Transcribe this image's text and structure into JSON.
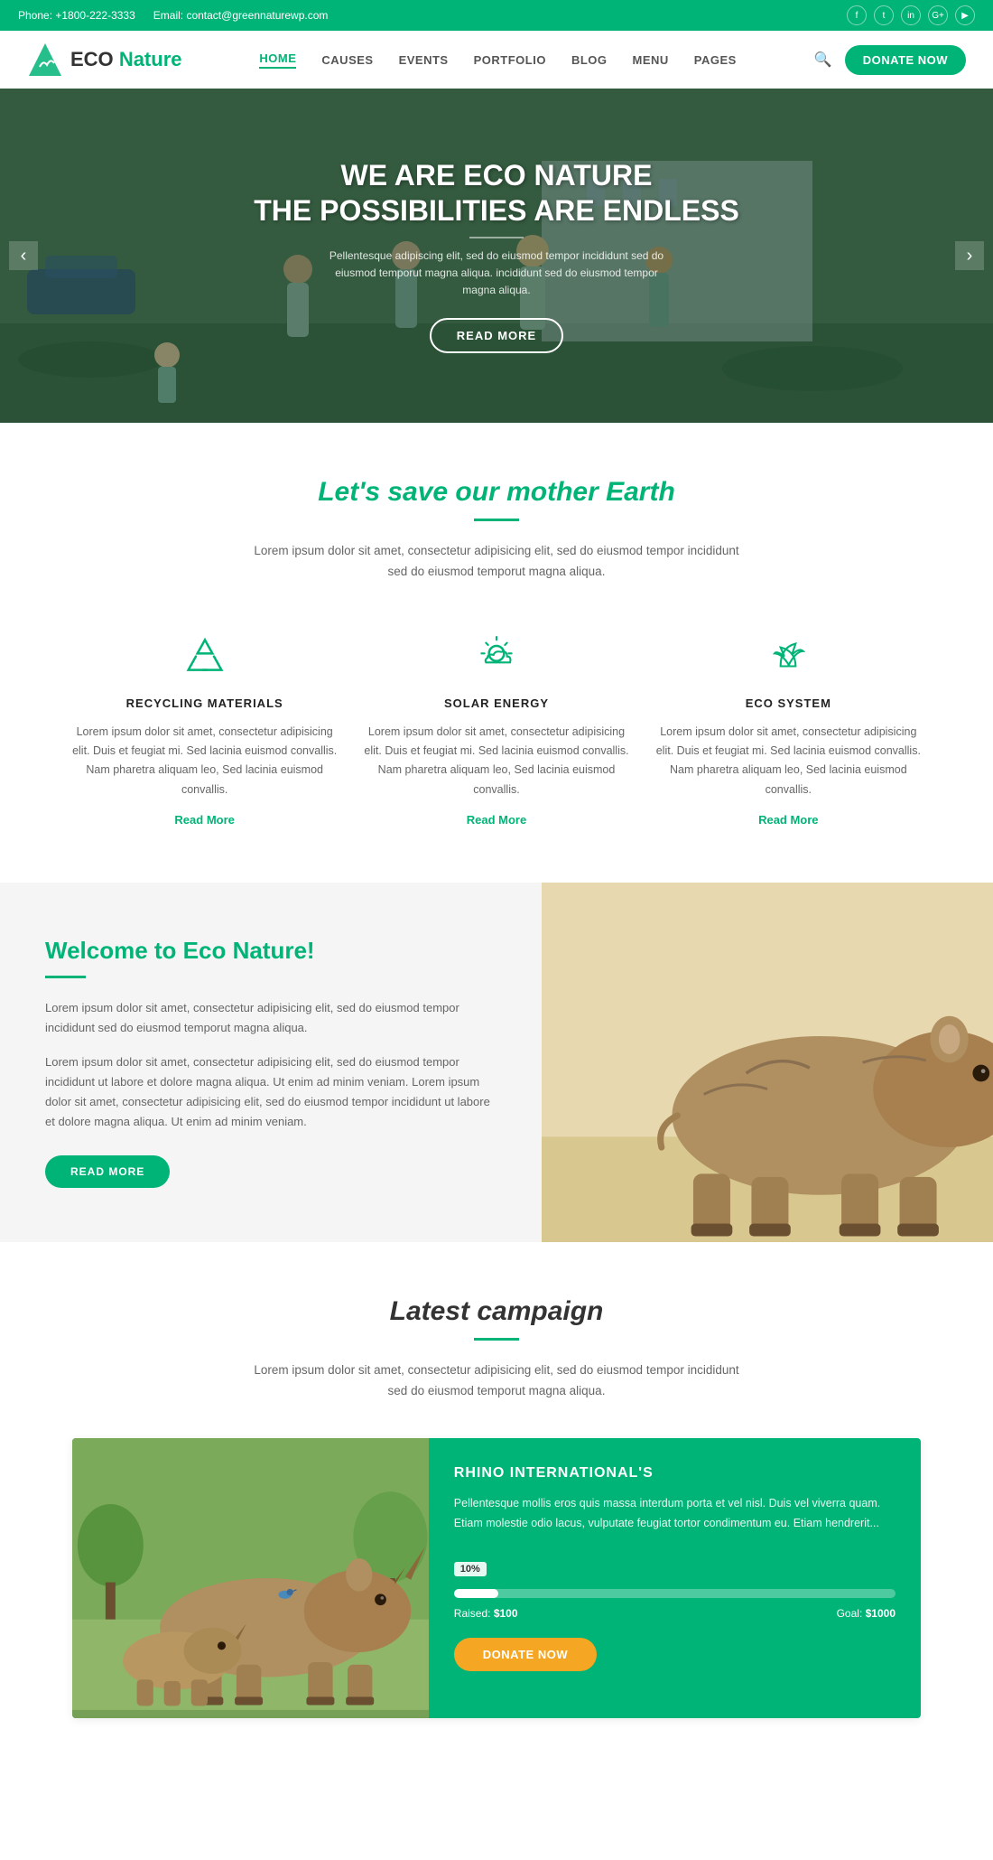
{
  "topbar": {
    "phone": "Phone: +1800-222-3333",
    "email": "Email: contact@greennaturewp.com",
    "socials": [
      "f",
      "t",
      "in",
      "G+",
      "▶"
    ]
  },
  "header": {
    "logo_eco": "ECO",
    "logo_nature": "Nature",
    "nav_items": [
      "HOME",
      "CAUSES",
      "EVENTS",
      "PORTFOLIO",
      "BLOG",
      "MENU",
      "PAGES"
    ],
    "donate_label": "DONATE NOW"
  },
  "hero": {
    "title_line1": "WE ARE ECO NATURE",
    "title_line2": "THE POSSIBILITIES ARE ENDLESS",
    "description": "Pellentesque adipiscing elit, sed do eiusmod tempor incididunt sed do eiusmod temporut magna aliqua. incididunt sed do eiusmod tempor magna aliqua.",
    "cta_label": "READ MORE",
    "prev_label": "‹",
    "next_label": "›"
  },
  "save_earth": {
    "title": "Let's save our mother Earth",
    "description": "Lorem ipsum dolor sit amet, consectetur adipisicing elit, sed do eiusmod tempor incididunt sed do eiusmod temporut magna aliqua.",
    "features": [
      {
        "id": "recycling",
        "title": "RECYCLING MATERIALS",
        "description": "Lorem ipsum dolor sit amet, consectetur adipisicing elit. Duis et feugiat mi. Sed lacinia euismod convallis. Nam pharetra aliquam leo, Sed lacinia euismod convallis.",
        "read_more": "Read More"
      },
      {
        "id": "solar",
        "title": "SOLAR ENERGY",
        "description": "Lorem ipsum dolor sit amet, consectetur adipisicing elit. Duis et feugiat mi. Sed lacinia euismod convallis. Nam pharetra aliquam leo, Sed lacinia euismod convallis.",
        "read_more": "Read More"
      },
      {
        "id": "ecosystem",
        "title": "ECO SYSTEM",
        "description": "Lorem ipsum dolor sit amet, consectetur adipisicing elit. Duis et feugiat mi. Sed lacinia euismod convallis. Nam pharetra aliquam leo, Sed lacinia euismod convallis.",
        "read_more": "Read More"
      }
    ]
  },
  "welcome": {
    "title": "Welcome to Eco Nature!",
    "para1": "Lorem ipsum dolor sit amet, consectetur adipisicing elit, sed do eiusmod tempor incididunt sed do eiusmod temporut magna aliqua.",
    "para2": "Lorem ipsum dolor sit amet, consectetur adipisicing elit, sed do eiusmod tempor incididunt ut labore et dolore magna aliqua. Ut enim ad minim veniam. Lorem ipsum dolor sit amet, consectetur adipisicing elit, sed do eiusmod tempor incididunt ut labore et dolore magna aliqua. Ut enim ad minim veniam.",
    "cta_label": "READ MORE"
  },
  "latest_campaign": {
    "title": "Latest campaign",
    "description": "Lorem ipsum dolor sit amet, consectetur adipisicing elit, sed do eiusmod tempor incididunt sed do eiusmod temporut magna aliqua.",
    "card": {
      "campaign_title": "RHINO INTERNATIONAL'S",
      "campaign_desc": "Pellentesque mollis eros quis massa interdum porta et vel nisl. Duis vel viverra quam. Etiam molestie odio lacus, vulputate feugiat tortor condimentum eu. Etiam hendrerit...",
      "progress_pct": 10,
      "progress_label": "10%",
      "raised_label": "Raised:",
      "raised_value": "$100",
      "goal_label": "Goal:",
      "goal_value": "$1000",
      "donate_label": "DONATE NOW"
    }
  },
  "colors": {
    "primary": "#00b377",
    "accent": "#f5a623",
    "text_dark": "#333",
    "text_mid": "#555",
    "text_light": "#666"
  }
}
